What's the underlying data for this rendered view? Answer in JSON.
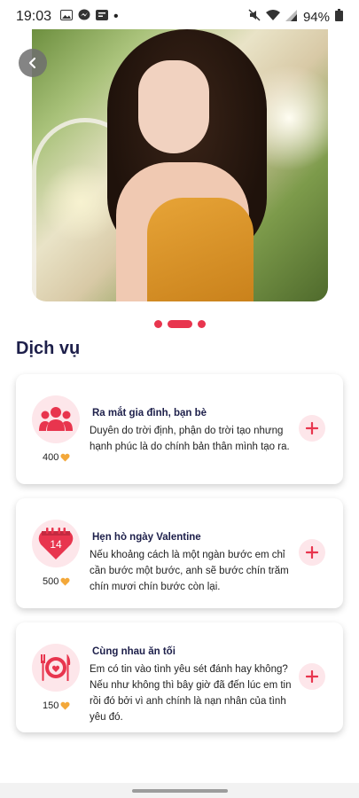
{
  "status_bar": {
    "time": "19:03",
    "battery": "94%",
    "dot": "•",
    "left_icons": [
      "image-icon",
      "messenger-icon",
      "message-icon"
    ],
    "right_icons": [
      "mute-icon",
      "wifi-icon",
      "signal-icon",
      "battery-icon"
    ]
  },
  "carousel": {
    "slide_count": 3,
    "active_index": 1
  },
  "section": {
    "title": "Dịch vụ"
  },
  "services": [
    {
      "icon": "family-icon",
      "price": "400",
      "title": "Ra mắt gia đình, bạn bè",
      "description": "Duyên do trời định, phận do trời tạo nhưng hạnh phúc là do chính bản thân mình tạo ra."
    },
    {
      "icon": "calendar-heart-icon",
      "calendar_day": "14",
      "price": "500",
      "title": "Hẹn hò ngày Valentine",
      "description": "Nếu khoảng cách là một ngàn bước em chỉ cần bước một bước, anh sẽ bước chín trăm chín mươi chín bước còn lại."
    },
    {
      "icon": "dinner-icon",
      "price": "150",
      "title": "Cùng nhau ăn tối",
      "description": "Em có tin vào tình yêu sét đánh hay không? Nếu như không thì bây giờ đã đến lúc em tin rồi đó bởi vì anh chính là nạn nhân của tình yêu đó."
    }
  ],
  "colors": {
    "accent": "#e8354e",
    "accent_soft": "#fde6ea",
    "heading": "#1d1f4a",
    "coin": "#f3a83a"
  }
}
